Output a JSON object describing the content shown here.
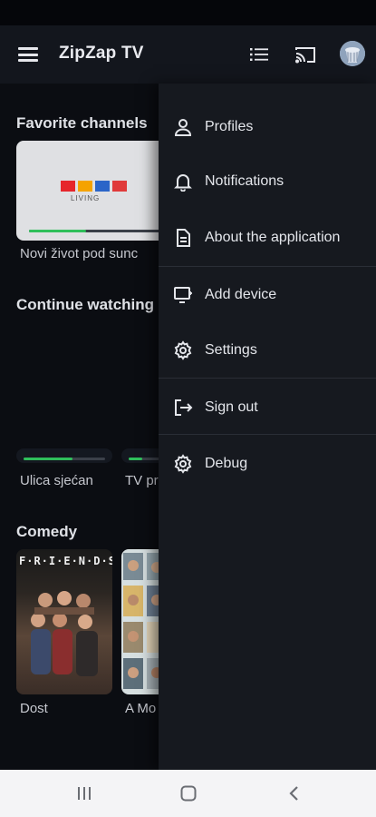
{
  "app": {
    "title": "ZipZap TV"
  },
  "icons": {
    "menu": "hamburger-menu-icon",
    "list": "list-icon",
    "cast": "cast-icon",
    "avatar": "user-avatar",
    "accent": "#2fbf5b"
  },
  "sections": {
    "favorites": {
      "title": "Favorite channels",
      "items": [
        {
          "caption": "Novi život pod sunc",
          "logo_text": "LIVING",
          "progress": 0.42
        }
      ]
    },
    "continue": {
      "title": "Continue watching",
      "items": [
        {
          "caption": "Ulica sjećan",
          "progress": 0.6
        },
        {
          "caption": "TV pr",
          "progress": 0.3
        }
      ]
    },
    "comedy": {
      "title": "Comedy",
      "items": [
        {
          "caption": "Dost",
          "poster_text": "F·R·I·E·N·D·S"
        },
        {
          "caption": "A Mo"
        }
      ]
    }
  },
  "drawer": {
    "items": [
      {
        "label": "Profiles",
        "icon": "person-icon"
      },
      {
        "label": "Notifications",
        "icon": "bell-icon"
      },
      {
        "label": "About the application",
        "icon": "document-icon"
      },
      {
        "label": "Add device",
        "icon": "add-device-icon"
      },
      {
        "label": "Settings",
        "icon": "gear-icon"
      },
      {
        "label": "Sign out",
        "icon": "sign-out-icon"
      },
      {
        "label": "Debug",
        "icon": "gear-icon"
      }
    ]
  },
  "navigation": [
    "recent-apps-icon",
    "home-icon",
    "back-icon"
  ]
}
